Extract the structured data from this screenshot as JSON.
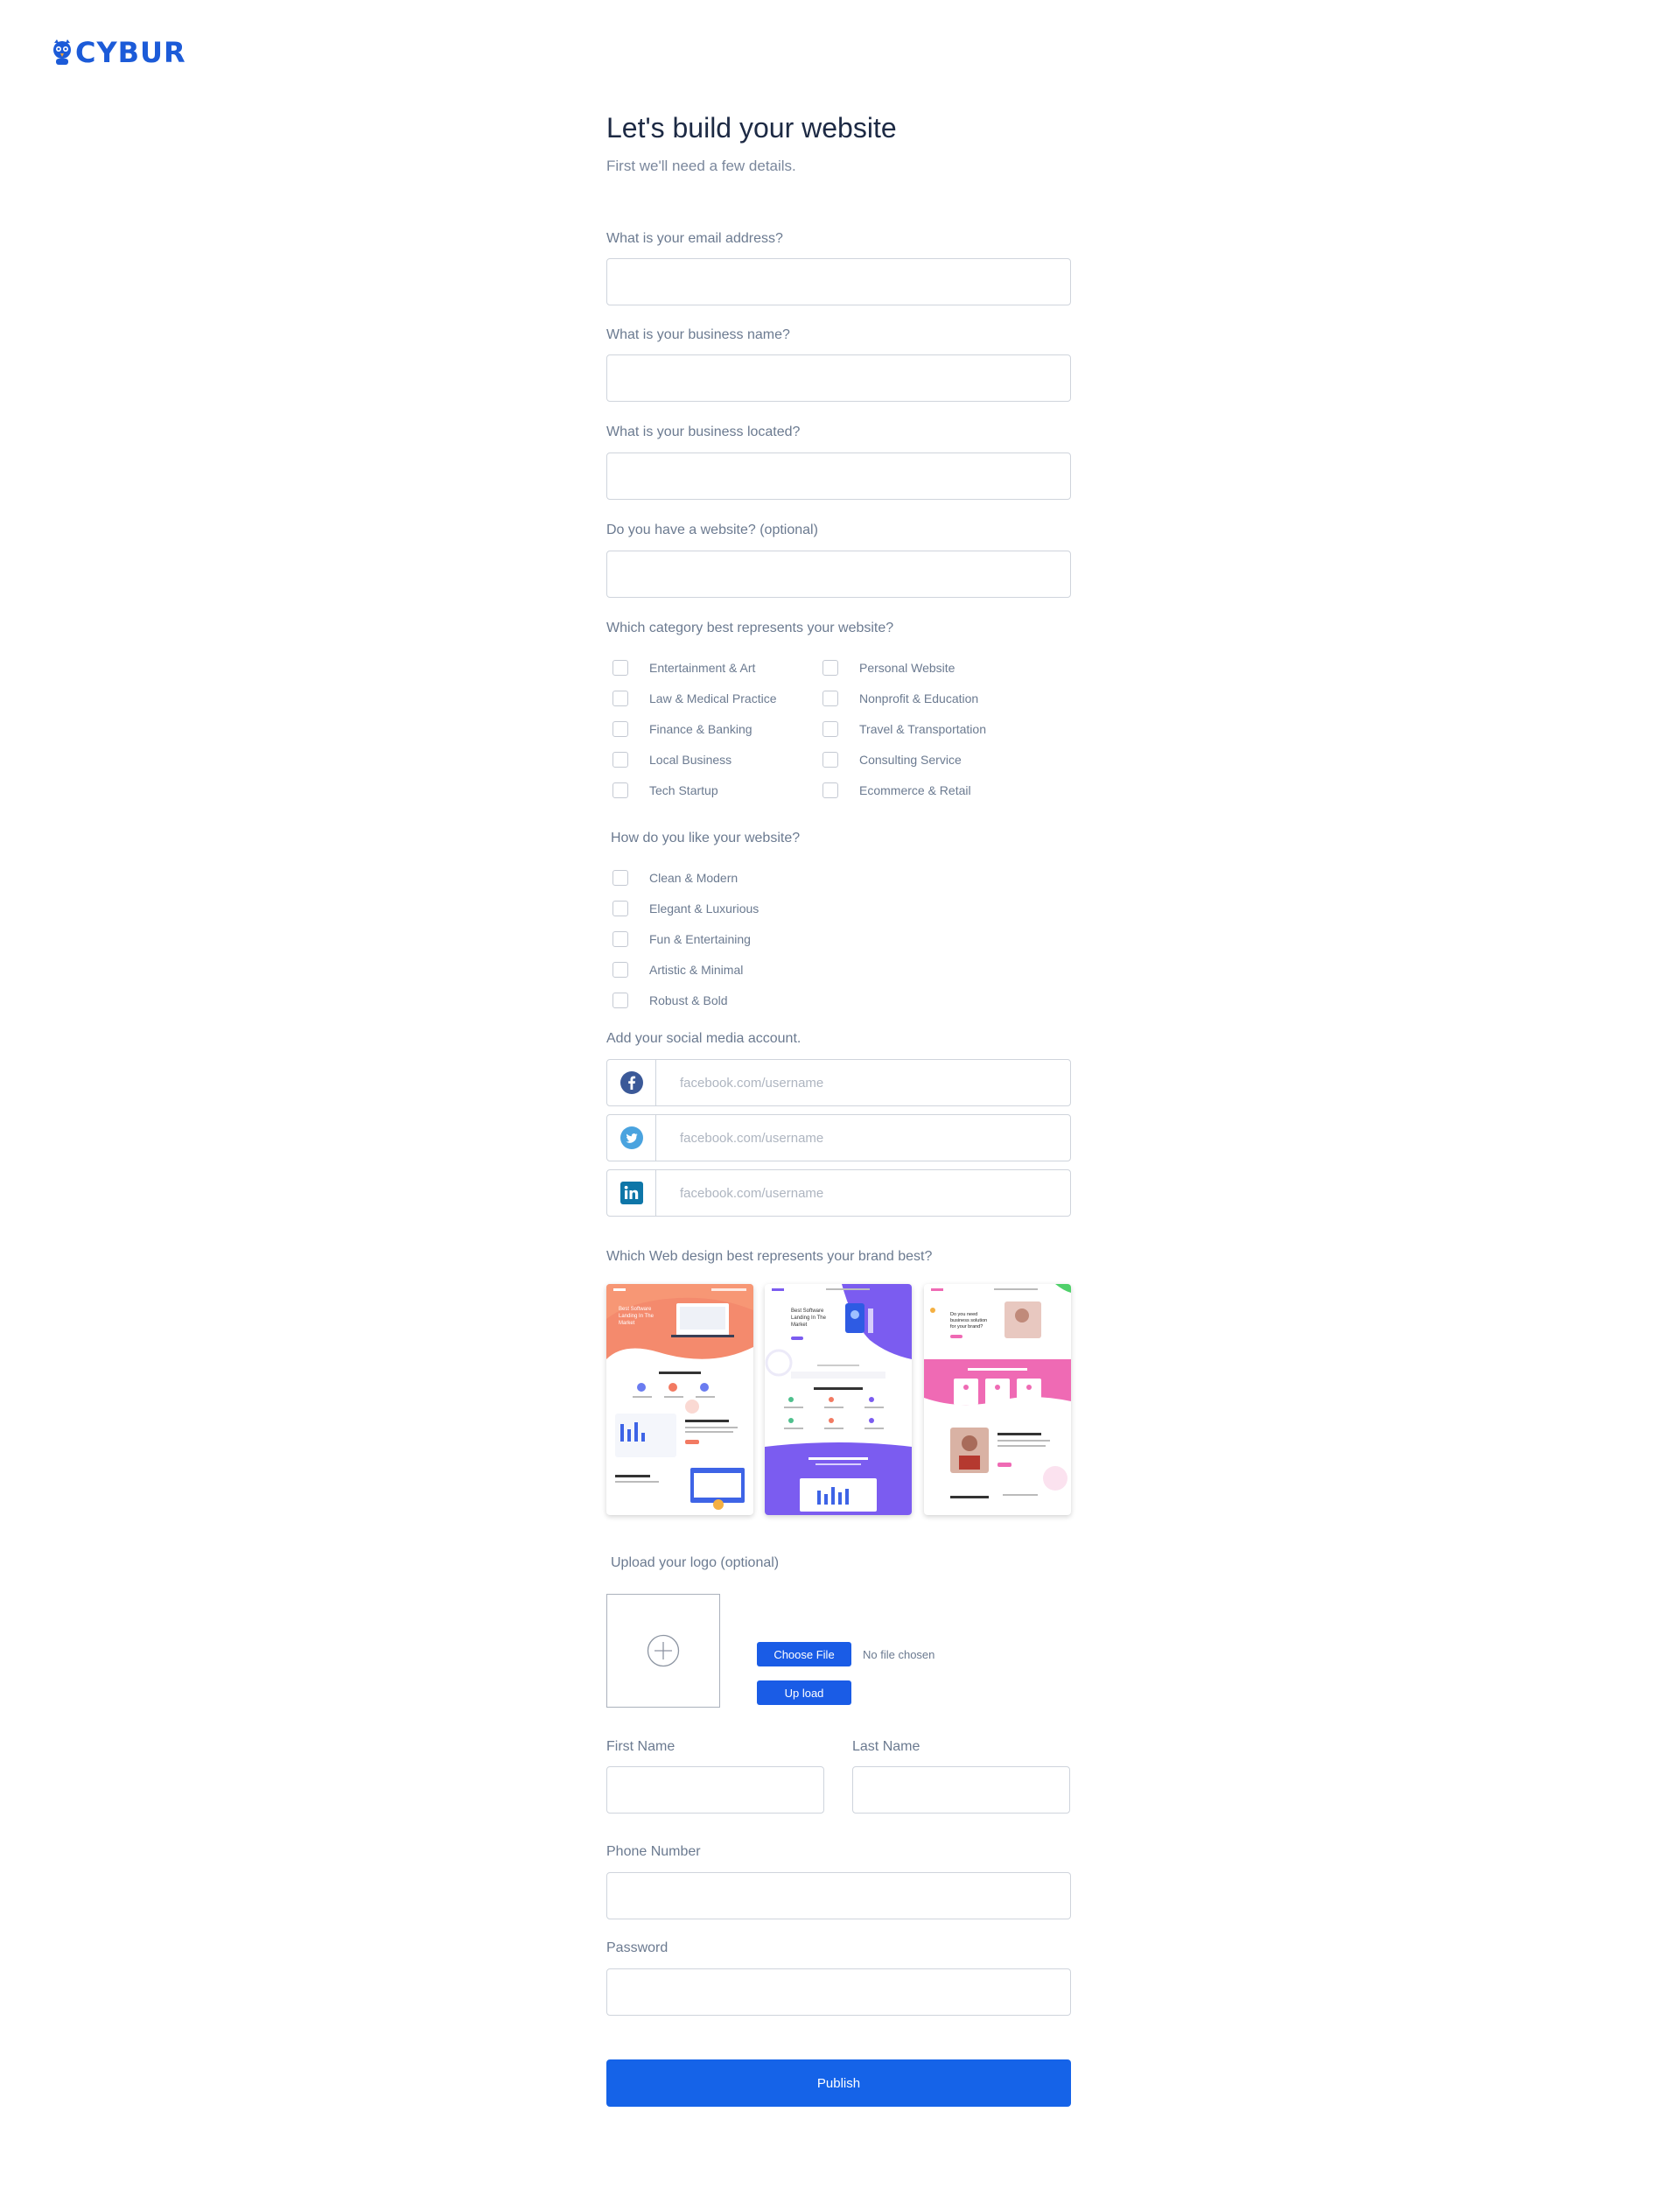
{
  "brand": {
    "name": "CYBUR",
    "color": "#1c5bd8"
  },
  "header": {
    "title": "Let's build your website",
    "subtitle": "First we'll need a few details."
  },
  "fields": {
    "email_label": "What is your email address?",
    "business_name_label": "What is your business name?",
    "location_label": "What is your business located?",
    "website_label": "Do you have a website? (optional)"
  },
  "category": {
    "question": "Which category best represents your website?",
    "left": [
      "Entertainment & Art",
      "Law & Medical Practice",
      "Finance & Banking",
      "Local Business",
      "Tech Startup"
    ],
    "right": [
      "Personal Website",
      "Nonprofit & Education",
      "Travel & Transportation",
      "Consulting Service",
      "Ecommerce & Retail"
    ]
  },
  "style": {
    "question": "How do you like your website?",
    "options": [
      "Clean & Modern",
      "Elegant & Luxurious",
      "Fun & Entertaining",
      "Artistic & Minimal",
      "Robust & Bold"
    ]
  },
  "social": {
    "label": "Add your social media account.",
    "accounts": [
      {
        "icon": "facebook-icon",
        "placeholder": "facebook.com/username"
      },
      {
        "icon": "twitter-icon",
        "placeholder": "facebook.com/username"
      },
      {
        "icon": "linkedin-icon",
        "placeholder": "facebook.com/username"
      }
    ]
  },
  "design": {
    "question": "Which Web design best represents your brand best?",
    "templates": [
      {
        "accent": "#f2735f",
        "hero_line1": "Best Software",
        "hero_line2": "Landing In The",
        "hero_line3": "Market"
      },
      {
        "accent": "#7b5cf0",
        "hero_line1": "Best Software",
        "hero_line2": "Landing In The",
        "hero_line3": "Market"
      },
      {
        "accent": "#ef6ab4",
        "hero_line1": "Do you need",
        "hero_line2": "business solution",
        "hero_line3": "for your brand?"
      }
    ]
  },
  "logo_upload": {
    "label": "Upload your logo (optional)",
    "choose_label": "Choose File",
    "no_file": "No file chosen",
    "upload_label": "Up load"
  },
  "contact": {
    "first_name_label": "First Name",
    "last_name_label": "Last Name",
    "phone_label": "Phone Number",
    "password_label": "Password"
  },
  "submit": {
    "label": "Publish",
    "color": "#1563e8"
  }
}
